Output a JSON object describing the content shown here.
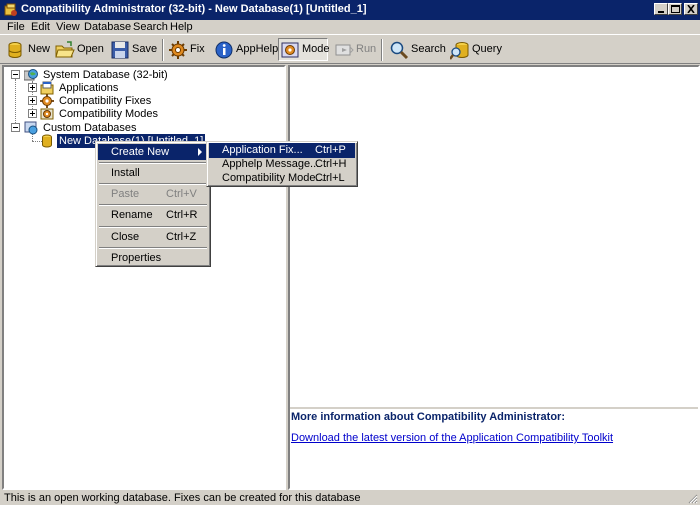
{
  "window": {
    "title": "Compatibility Administrator (32-bit) - New Database(1) [Untitled_1]"
  },
  "menu": [
    "File",
    "Edit",
    "View",
    "Database",
    "Search",
    "Help"
  ],
  "toolbar": {
    "new": "New",
    "open": "Open",
    "save": "Save",
    "fix": "Fix",
    "apphelp": "AppHelp",
    "mode": "Mode",
    "run": "Run",
    "search": "Search",
    "query": "Query"
  },
  "tree": {
    "system_db": "System Database (32-bit)",
    "applications": "Applications",
    "compat_fixes": "Compatibility Fixes",
    "compat_modes": "Compatibility Modes",
    "custom_dbs": "Custom Databases",
    "new_db": "New Database(1) [Untitled_1]"
  },
  "context_menu": {
    "create_new": "Create New",
    "install": "Install",
    "paste": "Paste",
    "paste_shortcut": "Ctrl+V",
    "rename": "Rename",
    "rename_shortcut": "Ctrl+R",
    "close": "Close",
    "close_shortcut": "Ctrl+Z",
    "properties": "Properties"
  },
  "submenu": {
    "app_fix": "Application Fix...",
    "app_fix_shortcut": "Ctrl+P",
    "apphelp_msg": "Apphelp Message...",
    "apphelp_msg_shortcut": "Ctrl+H",
    "compat_mode": "Compatibility Mode...",
    "compat_mode_shortcut": "Ctrl+L"
  },
  "info": {
    "title": "More information about Compatibility Administrator:",
    "link": "Download the latest version of the Application Compatibility Toolkit"
  },
  "status": "This is an open working database. Fixes can be created for this database",
  "colors": {
    "titlebar": "#0a246a",
    "face": "#d4d0c8",
    "selection": "#0a246a",
    "link": "#0000cc"
  }
}
